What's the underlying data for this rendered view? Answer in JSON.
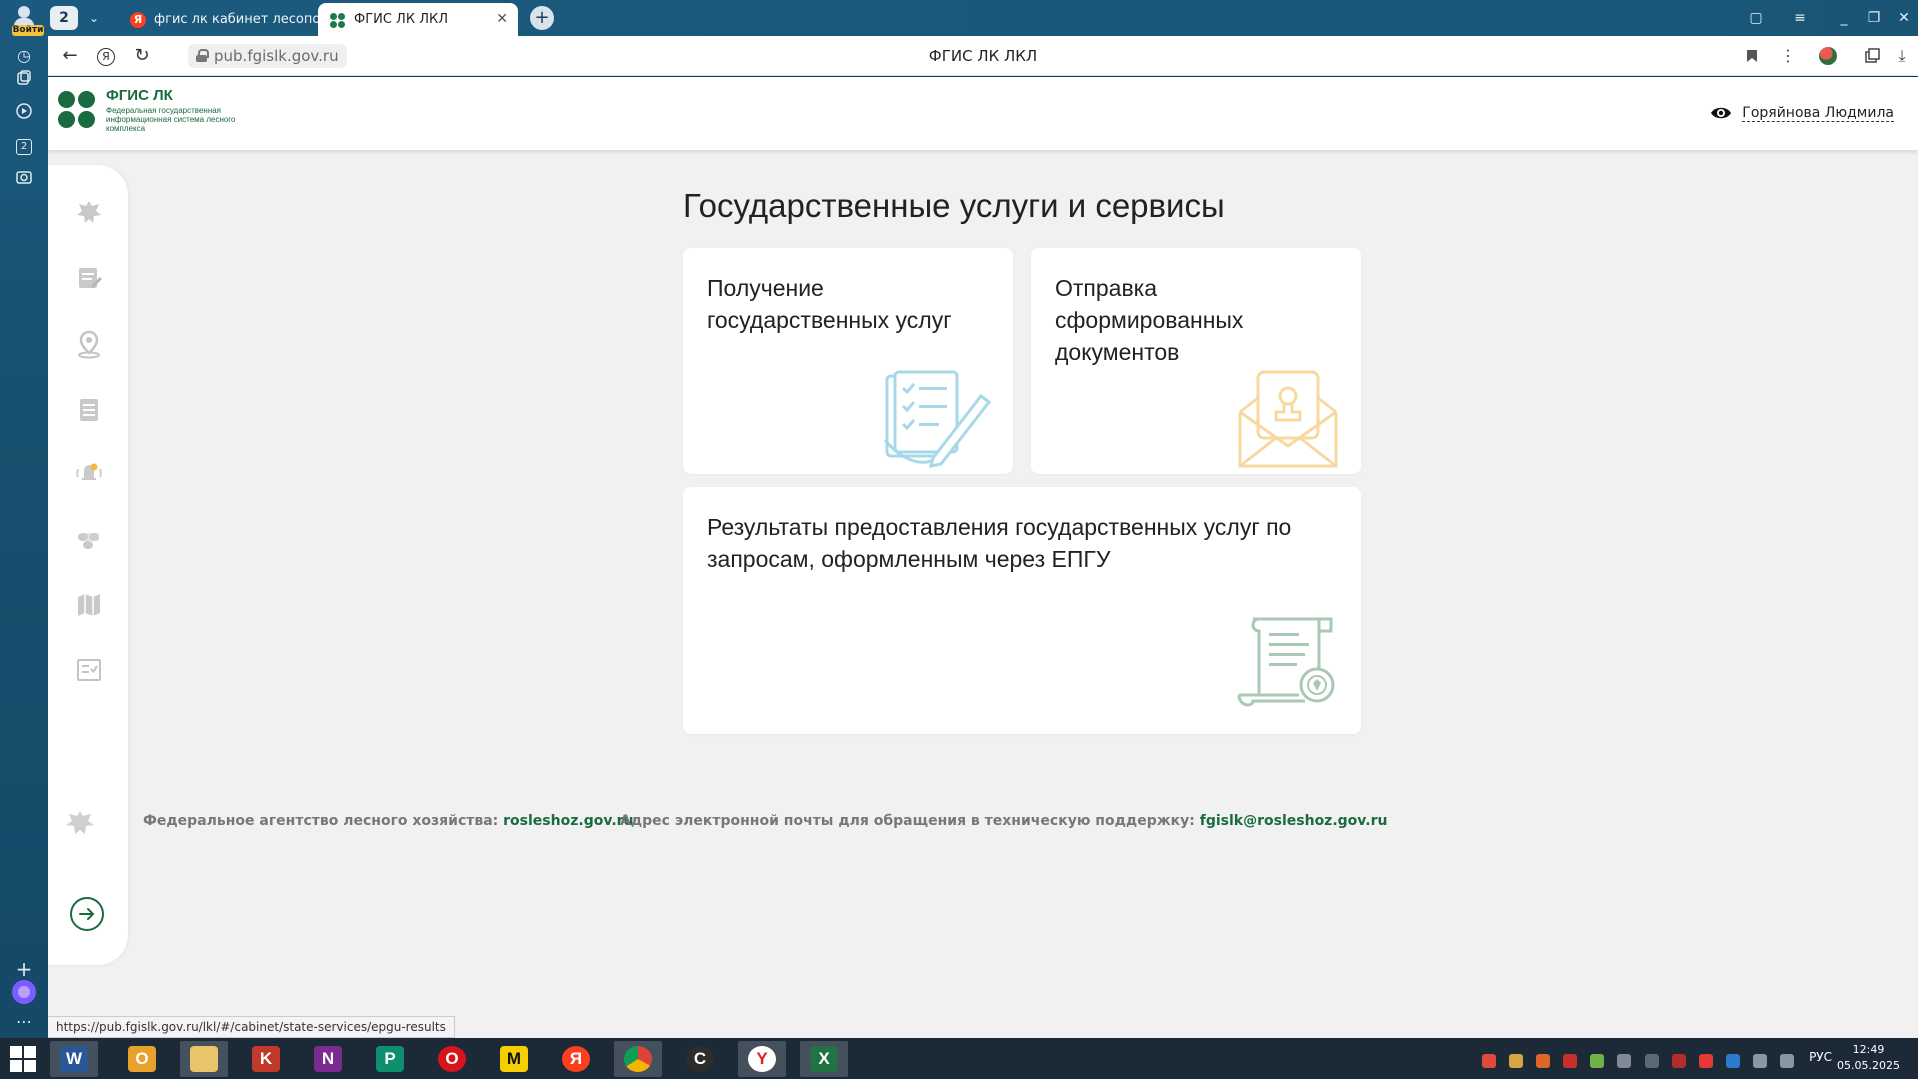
{
  "browser": {
    "sidebar": {
      "login_badge": "Войти",
      "tabs_count_badge": "2"
    },
    "tabs": {
      "count": "2",
      "inactive_title": "фгис лк кабинет лесопол",
      "active_title": "ФГИС ЛК ЛКЛ"
    },
    "address": {
      "url": "pub.fgislk.gov.ru",
      "page_title": "ФГИС ЛК ЛКЛ"
    },
    "status_link": "https://pub.fgislk.gov.ru/lkl/#/cabinet/state-services/epgu-results"
  },
  "site": {
    "logo": {
      "title": "ФГИС ЛК",
      "subtitle": "Федеральная государственная информационная система лесного комплекса"
    },
    "user_name": "Горяйнова Людмила",
    "section_title": "Государственные услуги и сервисы",
    "cards": [
      {
        "title": "Получение государственных услуг",
        "icon": "checklist-pencil-icon",
        "color": "#a8d8e8"
      },
      {
        "title": "Отправка сформированных документов",
        "icon": "envelope-stamp-icon",
        "color": "#f7d9a0"
      },
      {
        "title": "Результаты предоставления государственных услуг по запросам, оформленным через ЕПГУ",
        "icon": "scroll-seal-icon",
        "color": "#a9c9b4"
      }
    ],
    "footer": {
      "agency_label": "Федеральное агентство лесного хозяйства:",
      "agency_link": "rosleshoz.gov.ru",
      "support_label": "Адрес электронной почты для обращения в техническую поддержку:",
      "support_email": "fgislk@rosleshoz.gov.ru"
    },
    "accent_color": "#1a6b3f"
  },
  "taskbar": {
    "language": "РУС",
    "time": "12:49",
    "date": "05.05.2025"
  }
}
